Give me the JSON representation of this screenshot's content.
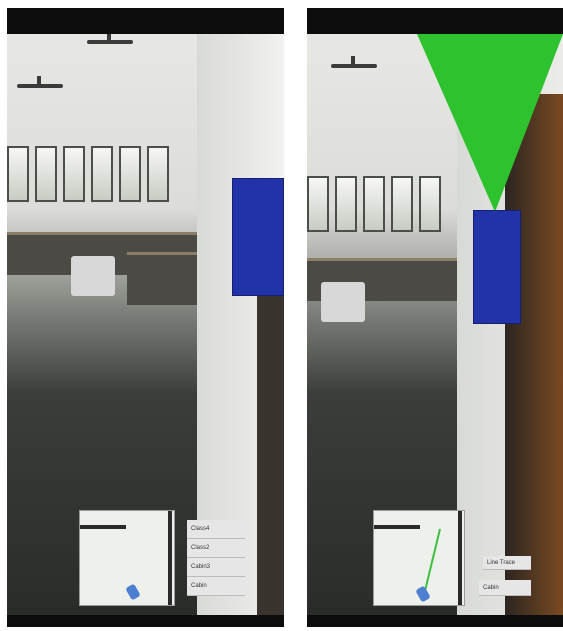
{
  "left_panel": {
    "menu_items": [
      "Class4",
      "Class2",
      "Cabin3",
      "Cabin"
    ]
  },
  "right_panel": {
    "route_label": "Line Trace",
    "destination_label": "Cabin"
  },
  "colors": {
    "marker_blue": "#2232a8",
    "direction_green": "#2fc22f"
  },
  "icons": {
    "avatar": "user-location-icon"
  }
}
